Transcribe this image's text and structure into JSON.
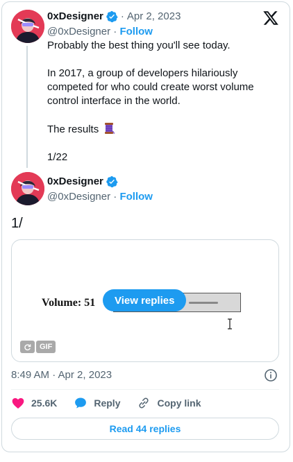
{
  "tweet1": {
    "display_name": "0xDesigner",
    "dot": "·",
    "date": "Apr 2, 2023",
    "handle": "@0xDesigner",
    "handle_dot": "·",
    "follow_label": "Follow",
    "text_line1": "Probably the best thing you'll see today.",
    "text_para2": "In 2017, a group of developers hilariously competed for who could create worst volume control interface in the world.",
    "text_line3": "The results",
    "text_line4": "1/22"
  },
  "tweet2": {
    "display_name": "0xDesigner",
    "handle": "@0xDesigner",
    "handle_dot": "·",
    "follow_label": "Follow",
    "text": "1/"
  },
  "media": {
    "volume_label": "Volume: 51",
    "view_replies_label": "View replies",
    "gif_label": "GIF"
  },
  "footer": {
    "timestamp": "8:49 AM · Apr 2, 2023",
    "like_count": "25.6K",
    "reply_label": "Reply",
    "copy_link_label": "Copy link",
    "read_replies_label": "Read 44 replies"
  },
  "colors": {
    "accent": "#1d9bf0",
    "like": "#f91880",
    "muted": "#536471"
  },
  "icons": [
    "verified-badge-icon",
    "x-logo-icon",
    "spool-emoji-icon",
    "replay-icon",
    "info-icon",
    "heart-icon",
    "reply-bubble-icon",
    "link-icon",
    "text-cursor-icon"
  ]
}
